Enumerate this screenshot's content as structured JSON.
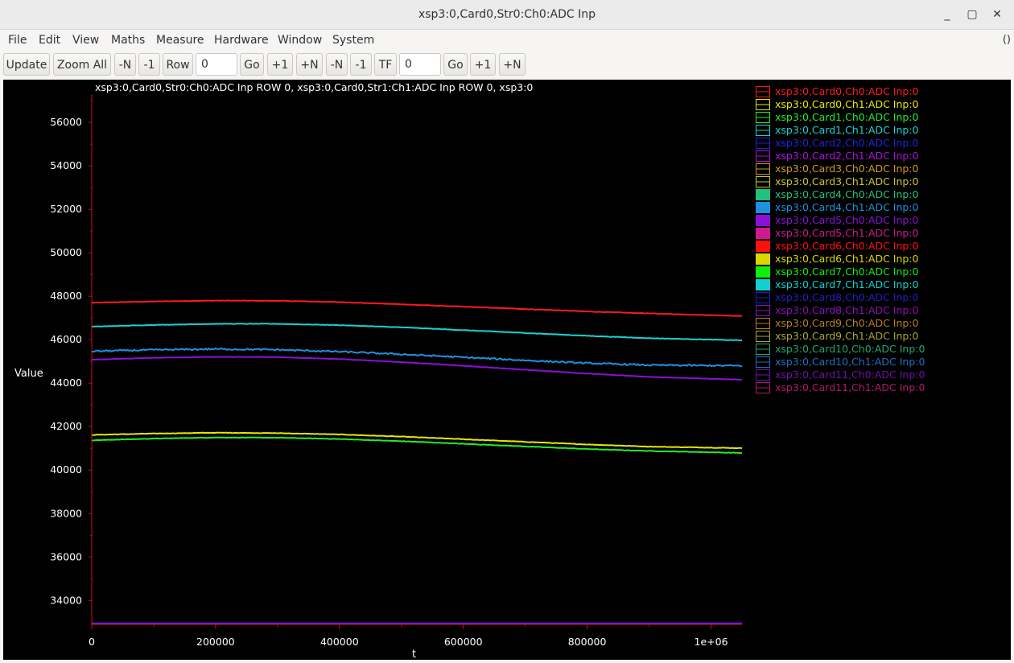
{
  "window": {
    "title": "xsp3:0,Card0,Str0:Ch0:ADC Inp",
    "controls": {
      "minimize": "_",
      "maximize": "▢",
      "close": "✕"
    }
  },
  "menubar": {
    "items": [
      "File",
      "Edit",
      "View",
      "Maths",
      "Measure",
      "Hardware",
      "Window",
      "System"
    ],
    "right_indicator": "()"
  },
  "toolbar": {
    "update": "Update",
    "zoom_all": "Zoom All",
    "minus_n_1": "-N",
    "minus_1_1": "-1",
    "row": "Row",
    "row_value": "0",
    "go_1": "Go",
    "plus_1_1": "+1",
    "plus_n_1": "+N",
    "minus_n_2": "-N",
    "minus_1_2": "-1",
    "tf": "TF",
    "tf_value": "0",
    "go_2": "Go",
    "plus_1_2": "+1",
    "plus_n_2": "+N"
  },
  "chart_data": {
    "type": "line",
    "title": "xsp3:0,Card0,Str0:Ch0:ADC Inp ROW 0, xsp3:0,Card0,Str1:Ch1:ADC Inp ROW 0, xsp3:0",
    "xlabel": "t",
    "ylabel": "Value",
    "xlim": [
      0,
      1050000
    ],
    "ylim": [
      32900,
      57300
    ],
    "x_ticks": [
      0,
      200000,
      400000,
      600000,
      800000,
      1000000
    ],
    "x_tick_labels": [
      "0",
      "200000",
      "400000",
      "600000",
      "800000",
      "1e+06"
    ],
    "y_ticks": [
      34000,
      36000,
      38000,
      40000,
      42000,
      44000,
      46000,
      48000,
      50000,
      52000,
      54000,
      56000
    ],
    "y_tick_labels": [
      "34000",
      "36000",
      "38000",
      "40000",
      "42000",
      "44000",
      "46000",
      "48000",
      "50000",
      "52000",
      "54000",
      "56000"
    ],
    "axis_color": "#cc1010",
    "background": "#000000",
    "legend_position": "right",
    "x": [
      0,
      100000,
      200000,
      300000,
      400000,
      500000,
      600000,
      700000,
      800000,
      900000,
      1050000
    ],
    "series": [
      {
        "name": "xsp3:0,Card0,Ch0:ADC Inp:0",
        "color": "#ff1a1a",
        "swatch": "outline",
        "noise": 10,
        "values": [
          47700,
          47760,
          47800,
          47790,
          47730,
          47630,
          47520,
          47410,
          47300,
          47210,
          47090
        ]
      },
      {
        "name": "xsp3:0,Card0,Ch1:ADC Inp:0",
        "color": "#e8e800",
        "swatch": "outline",
        "noise": 10,
        "values": [
          41620,
          41680,
          41720,
          41700,
          41640,
          41540,
          41420,
          41300,
          41180,
          41080,
          41010
        ]
      },
      {
        "name": "xsp3:0,Card1,Ch0:ADC Inp:0",
        "color": "#22ee22",
        "swatch": "outline",
        "noise": 10,
        "values": [
          41370,
          41450,
          41500,
          41490,
          41430,
          41330,
          41210,
          41090,
          40970,
          40880,
          40790
        ]
      },
      {
        "name": "xsp3:0,Card1,Ch1:ADC Inp:0",
        "color": "#19d2d2",
        "swatch": "outline",
        "noise": 10,
        "values": [
          46600,
          46680,
          46730,
          46730,
          46670,
          46570,
          46440,
          46310,
          46180,
          46070,
          45970
        ]
      },
      {
        "name": "xsp3:0,Card2,Ch0:ADC Inp:0",
        "color": "#2222dd",
        "swatch": "outline",
        "noise": 0,
        "values": [
          32950,
          32950,
          32950,
          32950,
          32950,
          32950,
          32950,
          32950,
          32950,
          32950,
          32950
        ]
      },
      {
        "name": "xsp3:0,Card2,Ch1:ADC Inp:0",
        "color": "#b010e0",
        "swatch": "outline",
        "noise": 0,
        "values": [
          32920,
          32920,
          32920,
          32920,
          32920,
          32920,
          32920,
          32920,
          32920,
          32920,
          32920
        ]
      },
      {
        "name": "xsp3:0,Card3,Ch0:ADC Inp:0",
        "color": "#d09a20",
        "swatch": "outline",
        "noise": 0,
        "values": []
      },
      {
        "name": "xsp3:0,Card3,Ch1:ADC Inp:0",
        "color": "#c8c830",
        "swatch": "outline",
        "noise": 0,
        "values": []
      },
      {
        "name": "xsp3:0,Card4,Ch0:ADC Inp:0",
        "color": "#20c080",
        "swatch": "filled",
        "noise": 0,
        "values": []
      },
      {
        "name": "xsp3:0,Card4,Ch1:ADC Inp:0",
        "color": "#1f8fe0",
        "swatch": "filled",
        "noise": 35,
        "values": [
          45470,
          45530,
          45570,
          45540,
          45450,
          45330,
          45190,
          45050,
          44920,
          44830,
          44800
        ]
      },
      {
        "name": "xsp3:0,Card5,Ch0:ADC Inp:0",
        "color": "#8a10d8",
        "swatch": "filled",
        "noise": 8,
        "values": [
          45080,
          45170,
          45210,
          45200,
          45110,
          44970,
          44800,
          44620,
          44440,
          44290,
          44160
        ]
      },
      {
        "name": "xsp3:0,Card5,Ch1:ADC Inp:0",
        "color": "#d01890",
        "swatch": "filled",
        "noise": 0,
        "values": []
      },
      {
        "name": "xsp3:0,Card6,Ch0:ADC Inp:0",
        "color": "#ff1010",
        "swatch": "filled",
        "noise": 0,
        "values": []
      },
      {
        "name": "xsp3:0,Card6,Ch1:ADC Inp:0",
        "color": "#d8d800",
        "swatch": "filled",
        "noise": 0,
        "values": []
      },
      {
        "name": "xsp3:0,Card7,Ch0:ADC Inp:0",
        "color": "#10ee10",
        "swatch": "filled",
        "noise": 0,
        "values": []
      },
      {
        "name": "xsp3:0,Card7,Ch1:ADC Inp:0",
        "color": "#10d0d0",
        "swatch": "filled",
        "noise": 0,
        "values": []
      },
      {
        "name": "xsp3:0,Card8,Ch0:ADC Inp:0",
        "color": "#2020c0",
        "swatch": "outline",
        "noise": 0,
        "values": []
      },
      {
        "name": "xsp3:0,Card8,Ch1:ADC Inp:0",
        "color": "#8a10b8",
        "swatch": "outline",
        "noise": 0,
        "values": []
      },
      {
        "name": "xsp3:0,Card9,Ch0:ADC Inp:0",
        "color": "#b88020",
        "swatch": "outline",
        "noise": 0,
        "values": []
      },
      {
        "name": "xsp3:0,Card9,Ch1:ADC Inp:0",
        "color": "#a8a830",
        "swatch": "outline",
        "noise": 0,
        "values": []
      },
      {
        "name": "xsp3:0,Card10,Ch0:ADC Inp:0",
        "color": "#20a870",
        "swatch": "outline",
        "noise": 0,
        "values": []
      },
      {
        "name": "xsp3:0,Card10,Ch1:ADC Inp:0",
        "color": "#2070c0",
        "swatch": "outline",
        "noise": 0,
        "values": []
      },
      {
        "name": "xsp3:0,Card11,Ch0:ADC Inp:0",
        "color": "#7010a8",
        "swatch": "outline",
        "noise": 0,
        "values": []
      },
      {
        "name": "xsp3:0,Card11,Ch1:ADC Inp:0",
        "color": "#b01870",
        "swatch": "outline",
        "noise": 0,
        "values": []
      }
    ]
  }
}
